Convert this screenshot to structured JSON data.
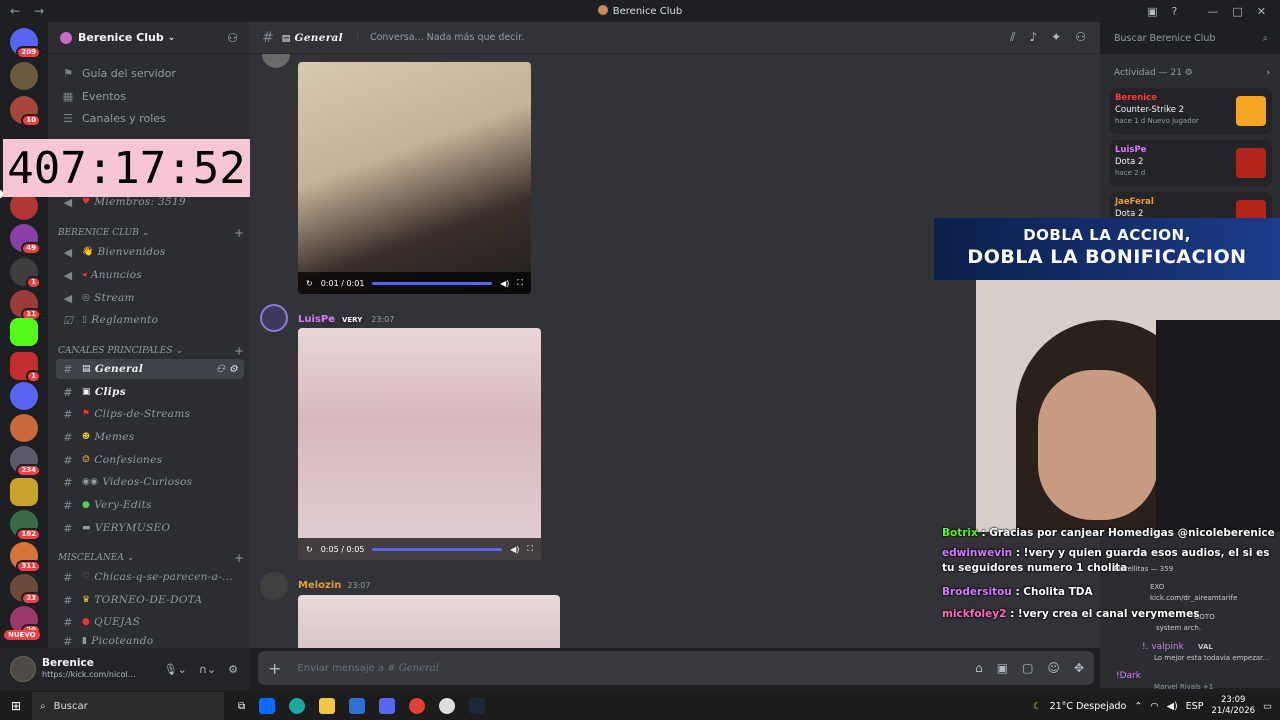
{
  "window": {
    "title": "Berenice Club"
  },
  "rail": {
    "badges": [
      "209",
      "10",
      "49",
      "1",
      "11",
      "1",
      "234",
      "182",
      "311",
      "23",
      "20"
    ],
    "new_label": "NUEVO"
  },
  "timer": "407:17:52",
  "server": {
    "name": "Berenice Club"
  },
  "sidebar": {
    "top_items": [
      "Guía del servidor",
      "Eventos",
      "Canales y roles"
    ],
    "members": "Miembros: 3519",
    "cat1": "BERENICE CLUB",
    "cat1_items": [
      "Bienvenidos",
      "Anuncios",
      "Stream",
      "Reglamento"
    ],
    "cat2": "CANALES PRINCIPALES",
    "cat2_items": [
      "General",
      "Clips",
      "Clips-de-Streams",
      "Memes",
      "Confesiones",
      "Videos-Curiosos",
      "Very-Edits",
      "VERYMUSEO"
    ],
    "cat3": "MISCELANEA",
    "cat3_items": [
      "Chicas-q-se-parecen-a-...",
      "TORNEO-DE-DOTA",
      "QUEJAS",
      "Picoteando"
    ]
  },
  "user": {
    "name": "Berenice",
    "status": "https://kick.com/nicole..."
  },
  "channel": {
    "name": "General",
    "topic": "Conversa... Nada más que decir."
  },
  "search": {
    "placeholder": "Buscar Berenice Club"
  },
  "messages": [
    {
      "video_time": "0:01 / 0:01"
    },
    {
      "author": "LuisPe",
      "tag": "VERY",
      "time": "23:07",
      "video_time": "0:05 / 0:05"
    },
    {
      "author": "Melozin",
      "time": "23:07"
    }
  ],
  "composer": {
    "prefix": "Enviar mensaje a #",
    "channel": "General"
  },
  "activity": {
    "header": "Actividad — 21",
    "cards": [
      {
        "who": "Berenice",
        "game": "Counter-Strike 2",
        "meta": "hace 1 d   Nuevo jugador",
        "color": "#f23f43"
      },
      {
        "who": "LuisPe",
        "game": "Dota 2",
        "meta": "hace 2 d",
        "color": "#d97aff"
      },
      {
        "who": "JaeFeral",
        "game": "Dota 2",
        "meta": "",
        "color": "#e89b3c"
      }
    ]
  },
  "banner": {
    "line1": "DOBLA LA ACCION,",
    "line2": "DOBLA LA BONIFICACION"
  },
  "chat": [
    {
      "user": "Botrix",
      "text": ": Gracias por canjear Homedigas @nicoleberenice",
      "color": "#53fc18"
    },
    {
      "user": "edwinwevin",
      "text": ": !very y quien guarda esos audios, el si es tu seguidores numero 1 cholita",
      "color": "#d97aff"
    },
    {
      "user": "Brodersitou",
      "text": ": Cholita TDA",
      "color": "#d97aff"
    },
    {
      "user": "mickfoley2",
      "text": ": !very crea el canal verymemes",
      "color": "#ff6ac1"
    }
  ],
  "faded": [
    "Estrellitas — 359",
    "EXO",
    "kick.com/dr_aireamtarife",
    "GOTO",
    "system arch.",
    "!. valpink",
    "VAL",
    "Lo mejor esta todavia empezar...",
    "!Dark",
    "Marvel Rivals +1"
  ],
  "taskbar": {
    "search": "Buscar",
    "weather": "21°C  Despejado",
    "lang": "ESP",
    "time": "23:09",
    "date": "21/4/2026"
  }
}
